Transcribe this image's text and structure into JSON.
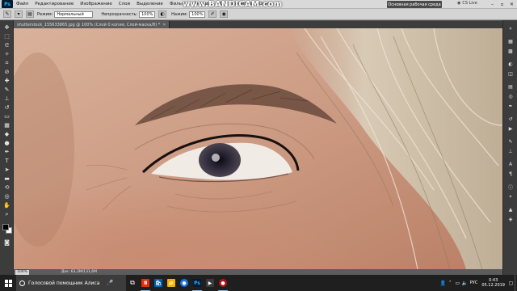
{
  "app": {
    "logo": "Ps"
  },
  "menu": [
    "Файл",
    "Редактирование",
    "Изображение",
    "Слои",
    "Выделение",
    "Фильтр",
    "Анализ",
    "3D",
    "Просмотр",
    "Окно"
  ],
  "menu_extra": [
    "Br",
    "Mb"
  ],
  "workspace": "Основная рабочая среда",
  "cs_live": "CS Live",
  "watermark": "www.BANDICAM.com",
  "options": {
    "mode_label": "Режим:",
    "mode_value": "Нормальный",
    "opacity_label": "Непрозрачность:",
    "opacity_value": "100%",
    "pressure_label": "Нажим:",
    "pressure_value": "100%"
  },
  "document": {
    "tab_title": "shutterstock_155633865.jpg @ 100% (Слой 0 копия, Слой-маска/8) *",
    "close": "✕"
  },
  "status": {
    "zoom": "100%",
    "doc_info": "Док: 63,3M/131,6M"
  },
  "taskbar": {
    "assistant": "Голосовой помощник Алиса",
    "mic": "🎤",
    "apps": [
      {
        "name": "task-view",
        "glyph": "⧉",
        "color": "#1f1f1f"
      },
      {
        "name": "yandex-browser",
        "glyph": "Я",
        "color": "#e62e04"
      },
      {
        "name": "store",
        "glyph": "🛍",
        "color": "#0063b1"
      },
      {
        "name": "file-explorer",
        "glyph": "📁",
        "color": "#f3b200"
      },
      {
        "name": "chrome",
        "glyph": "●",
        "color": "#1a73e8"
      },
      {
        "name": "photoshop",
        "glyph": "Ps",
        "color": "#001d34"
      },
      {
        "name": "media-player",
        "glyph": "▶",
        "color": "#3a3a3a"
      },
      {
        "name": "bandicam",
        "glyph": "●",
        "color": "#b0141c"
      }
    ],
    "lang": "РУС",
    "time": "0:43",
    "date": "05.12.2019"
  }
}
